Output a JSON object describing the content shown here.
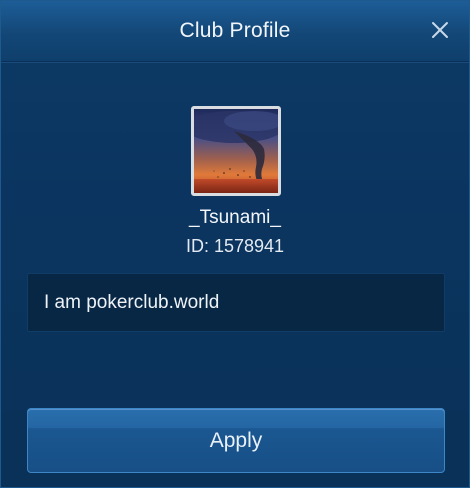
{
  "dialog": {
    "title": "Club Profile",
    "close_icon": "close-icon"
  },
  "club": {
    "avatar_icon": "tornado-image",
    "name": "_Tsunami_",
    "id_text": "ID: 1578941",
    "description": "I am pokerclub.world"
  },
  "actions": {
    "apply_label": "Apply"
  },
  "colors": {
    "header": "#134777",
    "background": "#0b3560",
    "input_bg": "#072745",
    "button": "#1f5f9b"
  }
}
